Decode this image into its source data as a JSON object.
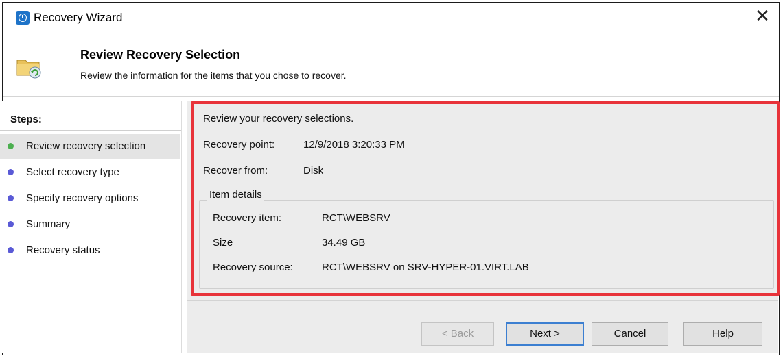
{
  "window": {
    "title": "Recovery Wizard",
    "close_glyph": "✕"
  },
  "header": {
    "title": "Review Recovery Selection",
    "subtitle": "Review the information for the items that you chose to recover."
  },
  "steps": {
    "heading": "Steps:",
    "items": [
      {
        "label": "Review recovery selection",
        "dot_color": "#4caf50"
      },
      {
        "label": "Select recovery type",
        "dot_color": "#5a5ad6"
      },
      {
        "label": "Specify recovery options",
        "dot_color": "#5a5ad6"
      },
      {
        "label": "Summary",
        "dot_color": "#5a5ad6"
      },
      {
        "label": "Recovery status",
        "dot_color": "#5a5ad6"
      }
    ]
  },
  "review": {
    "intro": "Review your recovery selections.",
    "recovery_point_label": "Recovery point:",
    "recovery_point_value": "12/9/2018 3:20:33 PM",
    "recover_from_label": "Recover from:",
    "recover_from_value": "Disk"
  },
  "item_details": {
    "legend": "Item details",
    "recovery_item_label": "Recovery item:",
    "recovery_item_value": "RCT\\WEBSRV",
    "size_label": "Size",
    "size_value": "34.49 GB",
    "recovery_source_label": "Recovery source:",
    "recovery_source_value": "RCT\\WEBSRV on SRV-HYPER-01.VIRT.LAB"
  },
  "buttons": {
    "back": "< Back",
    "next": "Next >",
    "cancel": "Cancel",
    "help": "Help"
  },
  "colors": {
    "highlight": "#e8333a",
    "accent": "#3c7fd1"
  }
}
